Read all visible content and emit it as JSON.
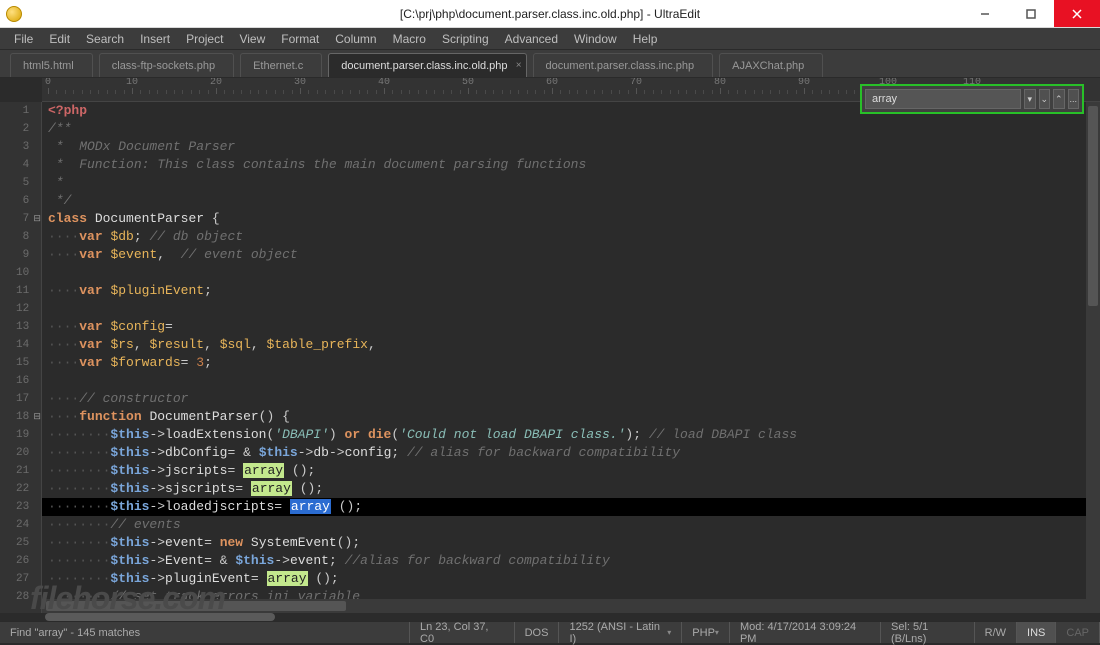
{
  "window": {
    "title": "[C:\\prj\\php\\document.parser.class.inc.old.php] - UltraEdit"
  },
  "menu": [
    "File",
    "Edit",
    "Search",
    "Insert",
    "Project",
    "View",
    "Format",
    "Column",
    "Macro",
    "Scripting",
    "Advanced",
    "Window",
    "Help"
  ],
  "tabs": [
    {
      "label": "html5.html",
      "active": false
    },
    {
      "label": "class-ftp-sockets.php",
      "active": false
    },
    {
      "label": "Ethernet.c",
      "active": false
    },
    {
      "label": "document.parser.class.inc.old.php",
      "active": true
    },
    {
      "label": "document.parser.class.inc.php",
      "active": false
    },
    {
      "label": "AJAXChat.php",
      "active": false
    }
  ],
  "ruler": {
    "col_width": 8.4,
    "marks": [
      0,
      10,
      20,
      30,
      40,
      50,
      60,
      70,
      80,
      90,
      100,
      110
    ]
  },
  "search": {
    "value": "array",
    "btn_next": "⌄",
    "btn_prev": "⌃",
    "btn_more": "..."
  },
  "code": {
    "lines": [
      {
        "n": 1,
        "fold": "",
        "html": "<span class='k-php'>&lt;?php</span>"
      },
      {
        "n": 2,
        "fold": "",
        "html": "<span class='k-com'>/**</span>"
      },
      {
        "n": 3,
        "fold": "",
        "html": "<span class='k-com'>&nbsp;*&nbsp;&nbsp;MODx&nbsp;Document&nbsp;Parser</span>"
      },
      {
        "n": 4,
        "fold": "",
        "html": "<span class='k-com'>&nbsp;*&nbsp;&nbsp;Function:&nbsp;This&nbsp;class&nbsp;contains&nbsp;the&nbsp;main&nbsp;document&nbsp;parsing&nbsp;functions</span>"
      },
      {
        "n": 5,
        "fold": "",
        "html": "<span class='k-com'>&nbsp;*</span>"
      },
      {
        "n": 6,
        "fold": "",
        "html": "<span class='k-com'>&nbsp;*/</span>"
      },
      {
        "n": 7,
        "fold": "⊟",
        "html": "<span class='k-key'>class</span> <span class='k-class'>DocumentParser</span> <span class='k-punc'>{</span>"
      },
      {
        "n": 8,
        "fold": "",
        "html": "<span class='k-dot'>····</span><span class='k-key'>var</span> <span class='k-var'>$db</span><span class='k-punc'>;</span> <span class='k-com'>// db object</span>"
      },
      {
        "n": 9,
        "fold": "",
        "html": "<span class='k-dot'>····</span><span class='k-key'>var</span> <span class='k-var'>$event</span><span class='k-punc'>,</span>  <span class='k-com'>// event object</span>"
      },
      {
        "n": 10,
        "fold": "",
        "html": ""
      },
      {
        "n": 11,
        "fold": "",
        "html": "<span class='k-dot'>····</span><span class='k-key'>var</span> <span class='k-var'>$pluginEvent</span><span class='k-punc'>;</span>"
      },
      {
        "n": 12,
        "fold": "",
        "html": ""
      },
      {
        "n": 13,
        "fold": "",
        "html": "<span class='k-dot'>····</span><span class='k-key'>var</span> <span class='k-var'>$config</span><span class='k-punc'>=</span>"
      },
      {
        "n": 14,
        "fold": "",
        "html": "<span class='k-dot'>····</span><span class='k-key'>var</span> <span class='k-var'>$rs</span><span class='k-punc'>,</span> <span class='k-var'>$result</span><span class='k-punc'>,</span> <span class='k-var'>$sql</span><span class='k-punc'>,</span> <span class='k-var'>$table_prefix</span><span class='k-punc'>,</span>"
      },
      {
        "n": 15,
        "fold": "",
        "html": "<span class='k-dot'>····</span><span class='k-key'>var</span> <span class='k-var'>$forwards</span><span class='k-punc'>=</span> <span class='k-num'>3</span><span class='k-punc'>;</span>"
      },
      {
        "n": 16,
        "fold": "",
        "html": ""
      },
      {
        "n": 17,
        "fold": "",
        "html": "<span class='k-dot'>····</span><span class='k-com'>// constructor</span>"
      },
      {
        "n": 18,
        "fold": "⊟",
        "html": "<span class='k-dot'>····</span><span class='k-key'>function</span> <span class='k-class'>DocumentParser</span><span class='k-punc'>()</span> <span class='k-punc'>{</span>"
      },
      {
        "n": 19,
        "fold": "",
        "html": "<span class='k-dot'>········</span><span class='k-this'>$this</span><span class='k-punc'>-&gt;</span><span class='k-func'>loadExtension</span><span class='k-punc'>(</span><span class='k-str'>'DBAPI'</span><span class='k-punc'>)</span> <span class='k-key'>or</span> <span class='k-key'>die</span><span class='k-punc'>(</span><span class='k-str'>'Could not load DBAPI class.'</span><span class='k-punc'>);</span> <span class='k-com'>// load DBAPI class</span>"
      },
      {
        "n": 20,
        "fold": "",
        "html": "<span class='k-dot'>········</span><span class='k-this'>$this</span><span class='k-punc'>-&gt;</span><span class='k-func'>dbConfig</span><span class='k-punc'>=</span> <span class='k-punc'>&amp;</span> <span class='k-this'>$this</span><span class='k-punc'>-&gt;</span><span class='k-func'>db</span><span class='k-punc'>-&gt;</span><span class='k-func'>config</span><span class='k-punc'>;</span> <span class='k-com'>// alias for backward compatibility</span>"
      },
      {
        "n": 21,
        "fold": "",
        "html": "<span class='k-dot'>········</span><span class='k-this'>$this</span><span class='k-punc'>-&gt;</span><span class='k-func'>jscripts</span><span class='k-punc'>=</span> <span class='hl-y'>array</span> <span class='k-punc'>();</span>"
      },
      {
        "n": 22,
        "fold": "",
        "html": "<span class='k-dot'>········</span><span class='k-this'>$this</span><span class='k-punc'>-&gt;</span><span class='k-func'>sjscripts</span><span class='k-punc'>=</span> <span class='hl-y'>array</span> <span class='k-punc'>();</span>"
      },
      {
        "n": 23,
        "fold": "",
        "current": true,
        "html": "<span class='k-dot'>········</span><span class='k-this'>$this</span><span class='k-punc'>-&gt;</span><span class='k-func'>loadedjscripts</span><span class='k-punc'>=</span> <span class='hl-b'>array</span> <span class='k-punc'>();</span>"
      },
      {
        "n": 24,
        "fold": "",
        "html": "<span class='k-dot'>········</span><span class='k-com'>// events</span>"
      },
      {
        "n": 25,
        "fold": "",
        "html": "<span class='k-dot'>········</span><span class='k-this'>$this</span><span class='k-punc'>-&gt;</span><span class='k-func'>event</span><span class='k-punc'>=</span> <span class='k-new'>new</span> <span class='k-class'>SystemEvent</span><span class='k-punc'>();</span>"
      },
      {
        "n": 26,
        "fold": "",
        "html": "<span class='k-dot'>········</span><span class='k-this'>$this</span><span class='k-punc'>-&gt;</span><span class='k-func'>Event</span><span class='k-punc'>=</span> <span class='k-punc'>&amp;</span> <span class='k-this'>$this</span><span class='k-punc'>-&gt;</span><span class='k-func'>event</span><span class='k-punc'>;</span> <span class='k-com'>//alias for backward compatibility</span>"
      },
      {
        "n": 27,
        "fold": "",
        "html": "<span class='k-dot'>········</span><span class='k-this'>$this</span><span class='k-punc'>-&gt;</span><span class='k-func'>pluginEvent</span><span class='k-punc'>=</span> <span class='hl-y'>array</span> <span class='k-punc'>();</span>"
      },
      {
        "n": 28,
        "fold": "",
        "html": "<span class='k-dot'>········</span><span class='k-com'>// set track_errors ini variable</span>"
      }
    ]
  },
  "status": {
    "find": "Find \"array\" - 145 matches",
    "pos": "Ln 23, Col 37, C0",
    "eol": "DOS",
    "enc": "1252 (ANSI - Latin I)",
    "lang": "PHP",
    "mod": "Mod: 4/17/2014 3:09:24 PM",
    "sel": "Sel: 5/1 (B/Lns)",
    "rw": "R/W",
    "ins": "INS",
    "cap": "CAP"
  },
  "watermark": "filehorse.com"
}
